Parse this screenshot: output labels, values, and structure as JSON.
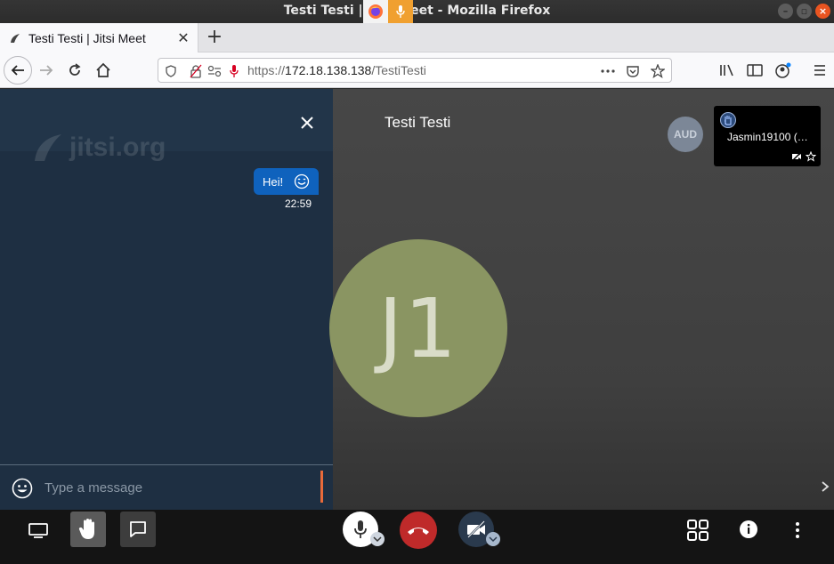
{
  "window": {
    "title": "Testi Testi | Jitsi Meet - Mozilla Firefox",
    "controls": [
      "minimize",
      "maximize",
      "close"
    ]
  },
  "browser": {
    "tab_title": "Testi Testi | Jitsi Meet",
    "url_prefix": "https://",
    "url_host": "172.18.138.138",
    "url_path": "/TestiTesti"
  },
  "chat": {
    "watermark": "jitsi.org",
    "messages": [
      {
        "text": "Hei!",
        "time": "22:59"
      }
    ],
    "input_placeholder": "Type a message"
  },
  "stage": {
    "meeting_title": "Testi Testi",
    "audio_badge": "AUD",
    "participant_thumb_name": "Jasmin19100 (…",
    "avatar_initials": "J1",
    "avatar_color": "#8a9562"
  },
  "toolbar": {
    "hangup_color": "#bf2a2a",
    "items": [
      "share-screen",
      "raise-hand",
      "chat",
      "microphone",
      "hangup",
      "camera",
      "tile-view",
      "info",
      "more"
    ]
  }
}
